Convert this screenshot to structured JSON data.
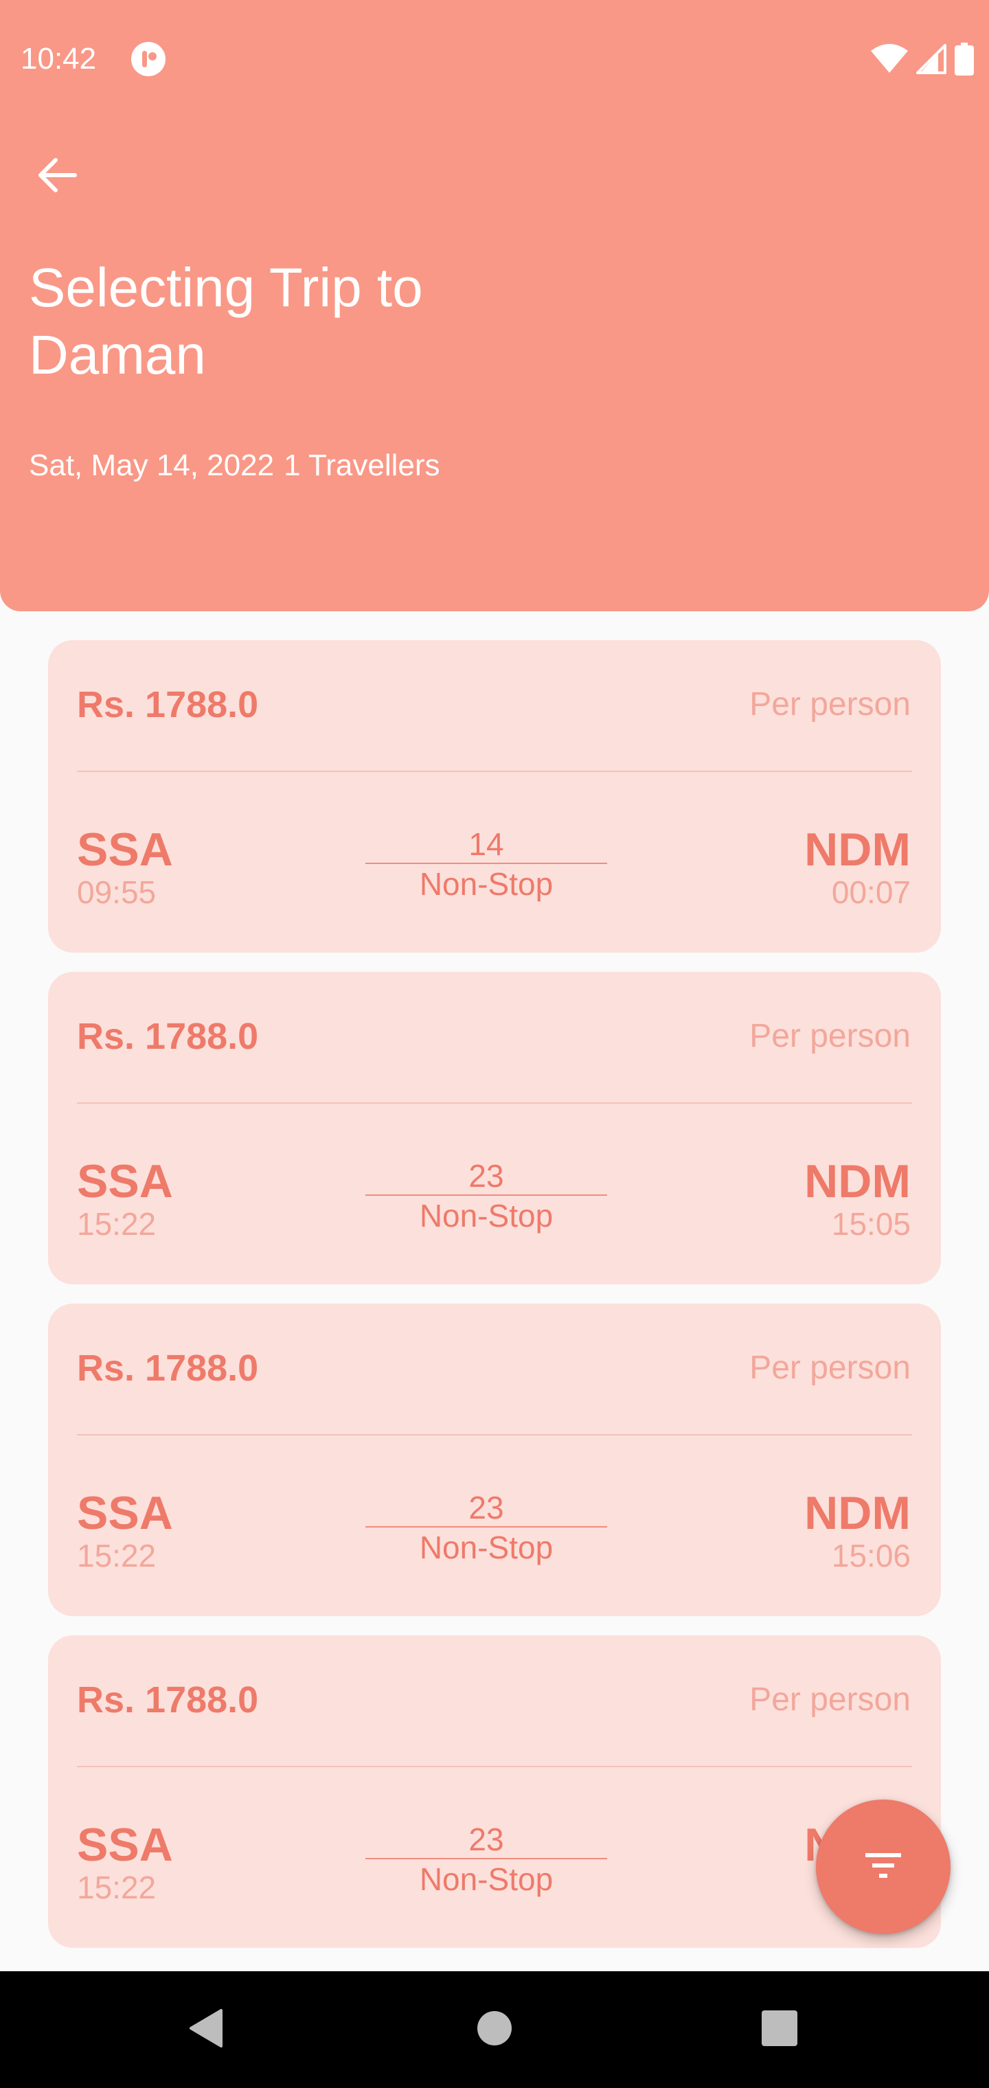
{
  "status_bar": {
    "time": "10:42",
    "icons": [
      "app-notification-icon",
      "wifi-icon",
      "cellular-signal-icon",
      "battery-icon"
    ]
  },
  "header": {
    "back_icon": "arrow-back-icon",
    "title": "Selecting Trip to Daman",
    "date": "Sat, May 14, 2022",
    "travellers": "1 Travellers",
    "background_color": "#F99887"
  },
  "flights": [
    {
      "price": "Rs. 1788.0",
      "price_note": "Per person",
      "from_code": "SSA",
      "from_time": "09:55",
      "duration": "14",
      "stops": "Non-Stop",
      "to_code": "NDM",
      "to_time": "00:07"
    },
    {
      "price": "Rs. 1788.0",
      "price_note": "Per person",
      "from_code": "SSA",
      "from_time": "15:22",
      "duration": "23",
      "stops": "Non-Stop",
      "to_code": "NDM",
      "to_time": "15:05"
    },
    {
      "price": "Rs. 1788.0",
      "price_note": "Per person",
      "from_code": "SSA",
      "from_time": "15:22",
      "duration": "23",
      "stops": "Non-Stop",
      "to_code": "NDM",
      "to_time": "15:06"
    },
    {
      "price": "Rs. 1788.0",
      "price_note": "Per person",
      "from_code": "SSA",
      "from_time": "15:22",
      "duration": "23",
      "stops": "Non-Stop",
      "to_code": "NDM",
      "to_time": ""
    }
  ],
  "fab": {
    "icon": "filter-icon"
  },
  "nav_bar": {
    "icons": [
      "nav-back-icon",
      "nav-home-icon",
      "nav-recents-icon"
    ]
  },
  "colors": {
    "accent": "#EE7A6A",
    "card_background": "#FCE0DB",
    "muted_text": "#F2A79B",
    "page_background": "#FAFAFA"
  }
}
